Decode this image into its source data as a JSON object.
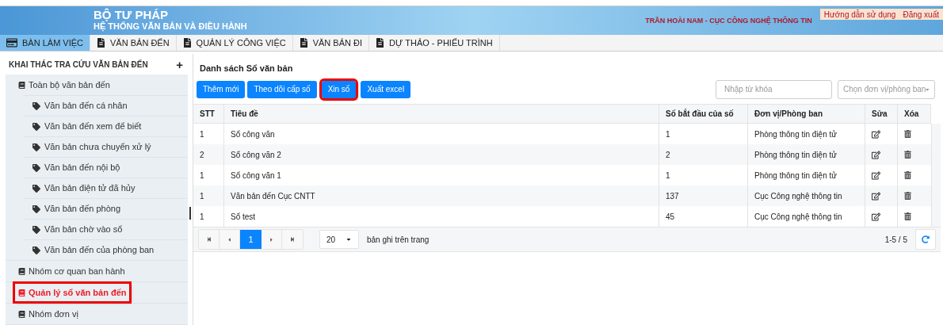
{
  "header": {
    "org": "BỘ TƯ PHÁP",
    "system": "HỆ THỐNG VĂN BẢN VÀ ĐIỀU HÀNH",
    "user": "TRẦN HOÀI NAM - CỤC CÔNG NGHỆ THÔNG TIN",
    "links": [
      "Hướng dẫn sử dụng",
      "Đăng xuất"
    ]
  },
  "nav_tabs": [
    {
      "label": "BÀN LÀM VIỆC",
      "kind": "card",
      "selected": true
    },
    {
      "label": "VĂN BẢN ĐẾN",
      "kind": "doc",
      "selected": false
    },
    {
      "label": "QUẢN LÝ CÔNG VIỆC",
      "kind": "doc",
      "selected": false
    },
    {
      "label": "VĂN BẢN ĐI",
      "kind": "doc",
      "selected": false
    },
    {
      "label": "DỰ THẢO - PHIẾU TRÌNH",
      "kind": "doc",
      "selected": false
    }
  ],
  "sidebar": {
    "title": "KHAI THÁC TRA CỨU VĂN BẢN ĐẾN",
    "add": "+",
    "items": [
      {
        "label": "Toàn bộ văn bản đến",
        "selected": false,
        "highlighted": false,
        "children": [
          {
            "label": "Văn bản đến cá nhân"
          },
          {
            "label": "Văn bản đến xem để biết"
          },
          {
            "label": "Văn bản chưa chuyển xử lý"
          },
          {
            "label": "Văn bản đến nội bộ"
          },
          {
            "label": "Văn bản điện tử đã hủy"
          },
          {
            "label": "Văn bản đến phòng"
          },
          {
            "label": "Văn bản chờ vào sổ"
          },
          {
            "label": "Văn bản đến của phòng ban"
          }
        ]
      },
      {
        "label": "Nhóm cơ quan ban hành",
        "selected": false,
        "highlighted": false
      },
      {
        "label": "Quản lý sổ văn bản đến",
        "selected": true,
        "highlighted": true
      },
      {
        "label": "Nhóm đơn vị",
        "selected": false,
        "highlighted": false
      }
    ]
  },
  "main": {
    "title": "Danh sách Sổ văn bản",
    "buttons": [
      {
        "label": "Thêm mới",
        "highlighted": false
      },
      {
        "label": "Theo dõi cấp số",
        "highlighted": false
      },
      {
        "label": "Xin số",
        "highlighted": true
      },
      {
        "label": "Xuất excel",
        "highlighted": false
      }
    ],
    "search": {
      "placeholder": "Nhập từ khóa"
    },
    "unit_select": {
      "placeholder": "Chọn đơn vị/phòng ban"
    },
    "table": {
      "columns": [
        "STT",
        "Tiêu đề",
        "Số bắt đầu của số",
        "Đơn vị/Phòng ban",
        "Sửa",
        "Xóa"
      ],
      "rows": [
        [
          "1",
          "Sổ công văn",
          "1",
          "Phòng thông tin điện tử"
        ],
        [
          "2",
          "Sổ công văn 2",
          "2",
          "Phòng thông tin điện tử"
        ],
        [
          "1",
          "Sổ công văn 1",
          "1",
          "Phòng thông tin điện tử"
        ],
        [
          "1",
          "Văn bản đến Cục CNTT",
          "137",
          "Cục Công nghệ thông tin"
        ],
        [
          "1",
          "Sổ test",
          "45",
          "Cục Công nghệ thông tin"
        ]
      ]
    },
    "pager": {
      "pages": [
        {
          "label": "1",
          "selected": true
        }
      ],
      "page_size": "20",
      "page_size_label": "bản ghi trên trang",
      "range": "1-5 / 5"
    }
  }
}
